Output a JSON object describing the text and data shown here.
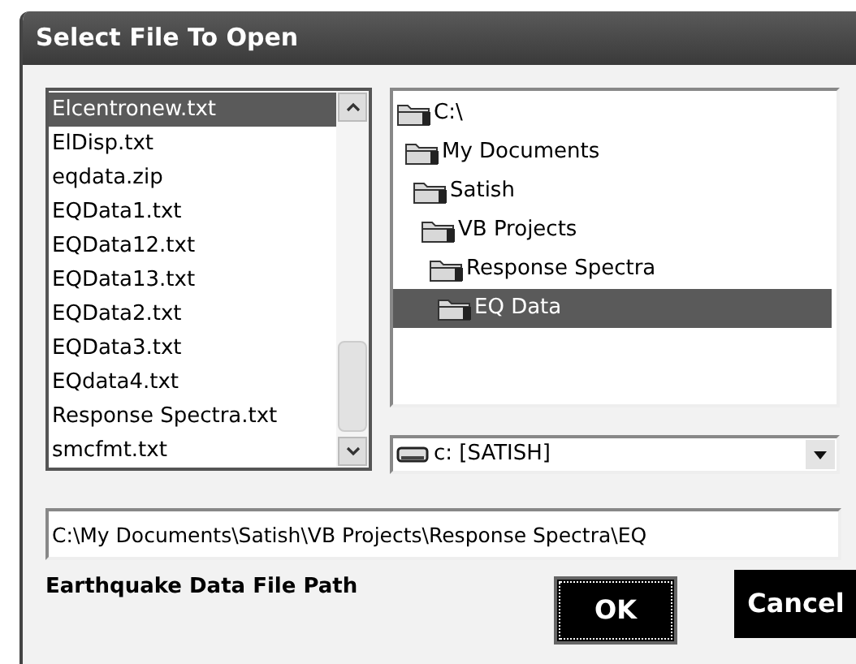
{
  "window": {
    "title": "Select File To Open"
  },
  "files": [
    {
      "name": "Elcentronew.txt",
      "selected": true
    },
    {
      "name": "ElDisp.txt",
      "selected": false
    },
    {
      "name": "eqdata.zip",
      "selected": false
    },
    {
      "name": "EQData1.txt",
      "selected": false
    },
    {
      "name": "EQData12.txt",
      "selected": false
    },
    {
      "name": "EQData13.txt",
      "selected": false
    },
    {
      "name": "EQData2.txt",
      "selected": false
    },
    {
      "name": "EQData3.txt",
      "selected": false
    },
    {
      "name": "EQdata4.txt",
      "selected": false
    },
    {
      "name": "Response Spectra.txt",
      "selected": false
    },
    {
      "name": "smcfmt.txt",
      "selected": false
    }
  ],
  "folders": [
    {
      "name": "C:\\",
      "selected": false,
      "children": [
        {
          "name": "My Documents",
          "selected": false,
          "children": [
            {
              "name": "Satish",
              "selected": false,
              "children": [
                {
                  "name": "VB Projects",
                  "selected": false,
                  "children": [
                    {
                      "name": "Response Spectra",
                      "selected": false,
                      "children": [
                        {
                          "name": "EQ Data",
                          "selected": true
                        }
                      ]
                    }
                  ]
                }
              ]
            }
          ]
        }
      ]
    }
  ],
  "drive": {
    "value": "c: [SATISH]"
  },
  "path_field": {
    "value": "C:\\My Documents\\Satish\\VB Projects\\Response Spectra\\EQ"
  },
  "path_label": "Earthquake Data File Path",
  "buttons": [
    {
      "label": "OK",
      "focused": true
    },
    {
      "label": "Cancel",
      "focused": false
    }
  ]
}
